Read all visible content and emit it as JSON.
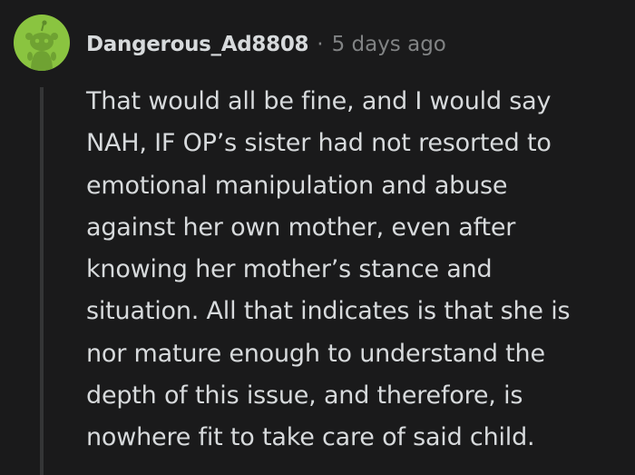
{
  "comment": {
    "author": "Dangerous_Ad8808",
    "separator": "·",
    "timestamp": "5 days ago",
    "avatar_icon": "snoo-avatar-icon",
    "avatar_color": "#8ac440",
    "body_lines": [
      "That would all be fine, and I would say",
      "NAH, IF OP’s sister had not resorted to",
      "emotional manipulation and abuse",
      "against her own mother, even after",
      "knowing her mother’s stance and",
      "situation. All that indicates is that she is",
      "nor mature enough to understand the",
      "depth of this issue, and therefore, is",
      "nowhere fit to take care of said child."
    ]
  }
}
